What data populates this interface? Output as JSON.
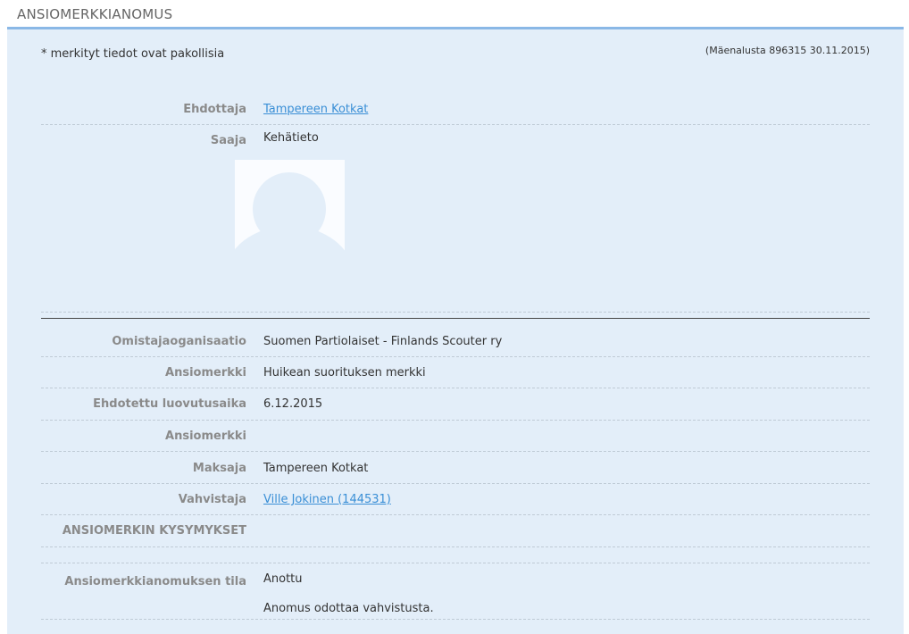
{
  "page": {
    "title": "ANSIOMERKKIANOMUS"
  },
  "form": {
    "required_note": "* merkityt tiedot ovat pakollisia",
    "meta": "(Mäenalusta 896315 30.11.2015)",
    "ehdottaja": {
      "label": "Ehdottaja",
      "value": "Tampereen Kotkat"
    },
    "saaja": {
      "label": "Saaja",
      "value": "Kehätieto"
    },
    "omistaja": {
      "label": "Omistajaoganisaatio",
      "value": "Suomen Partiolaiset - Finlands Scouter ry"
    },
    "ansiomerkki": {
      "label": "Ansiomerkki",
      "value": "Huikean suorituksen merkki"
    },
    "luovutusaika": {
      "label": "Ehdotettu luovutusaika",
      "value": "6.12.2015"
    },
    "ansiomerkki2": {
      "label": "Ansiomerkki",
      "value": ""
    },
    "maksaja": {
      "label": "Maksaja",
      "value": "Tampereen Kotkat"
    },
    "vahvistaja": {
      "label": "Vahvistaja",
      "value": "Ville Jokinen (144531)"
    },
    "kysymykset": {
      "label": "ANSIOMERKIN KYSYMYKSET"
    },
    "tila": {
      "label": "Ansiomerkkianomuksen tila",
      "value": "Anottu",
      "status_text": "Anomus odottaa vahvistusta."
    }
  },
  "icons": {
    "avatar": "user-placeholder-icon"
  }
}
